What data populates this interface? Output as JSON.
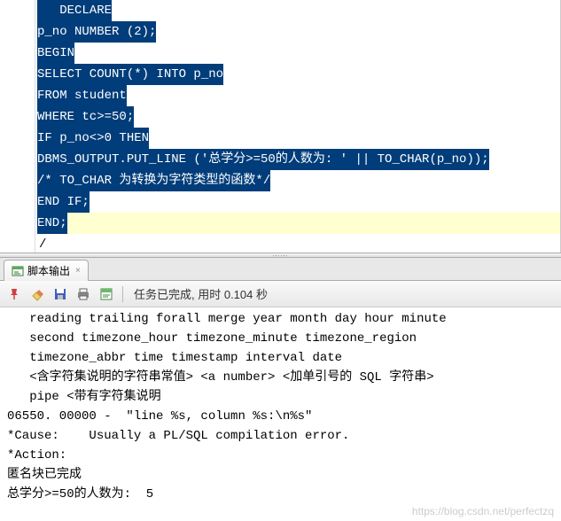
{
  "code": {
    "l1": "   DECLARE",
    "l2": "p_no NUMBER (2);",
    "l3": "BEGIN",
    "l4": "SELECT COUNT(*) INTO p_no",
    "l5": "FROM student",
    "l6": "WHERE tc>=50;",
    "l7": "IF p_no<>0 THEN",
    "l8": "DBMS_OUTPUT.PUT_LINE ('总学分>=50的人数为: ' || TO_CHAR(p_no));",
    "l9": "/* TO_CHAR 为转换为字符类型的函数*/",
    "l10": "END IF;",
    "l11": "END;",
    "l12": "/"
  },
  "tab": {
    "label": "脚本输出",
    "close": "×"
  },
  "status": "任务已完成, 用时 0.104 秒",
  "output": {
    "o1": "   reading trailing forall merge year month day hour minute",
    "o2": "   second timezone_hour timezone_minute timezone_region",
    "o3": "   timezone_abbr time timestamp interval date",
    "o4": "   <含字符集说明的字符串常值> <a number> <加单引号的 SQL 字符串>",
    "o5": "   pipe <带有字符集说明",
    "o6": "06550. 00000 -  \"line %s, column %s:\\n%s\"",
    "o7": "*Cause:    Usually a PL/SQL compilation error.",
    "o8": "*Action:",
    "o9": "匿名块已完成",
    "o10": "总学分>=50的人数为:  5"
  },
  "watermark": "https://blog.csdn.net/perfectzq"
}
